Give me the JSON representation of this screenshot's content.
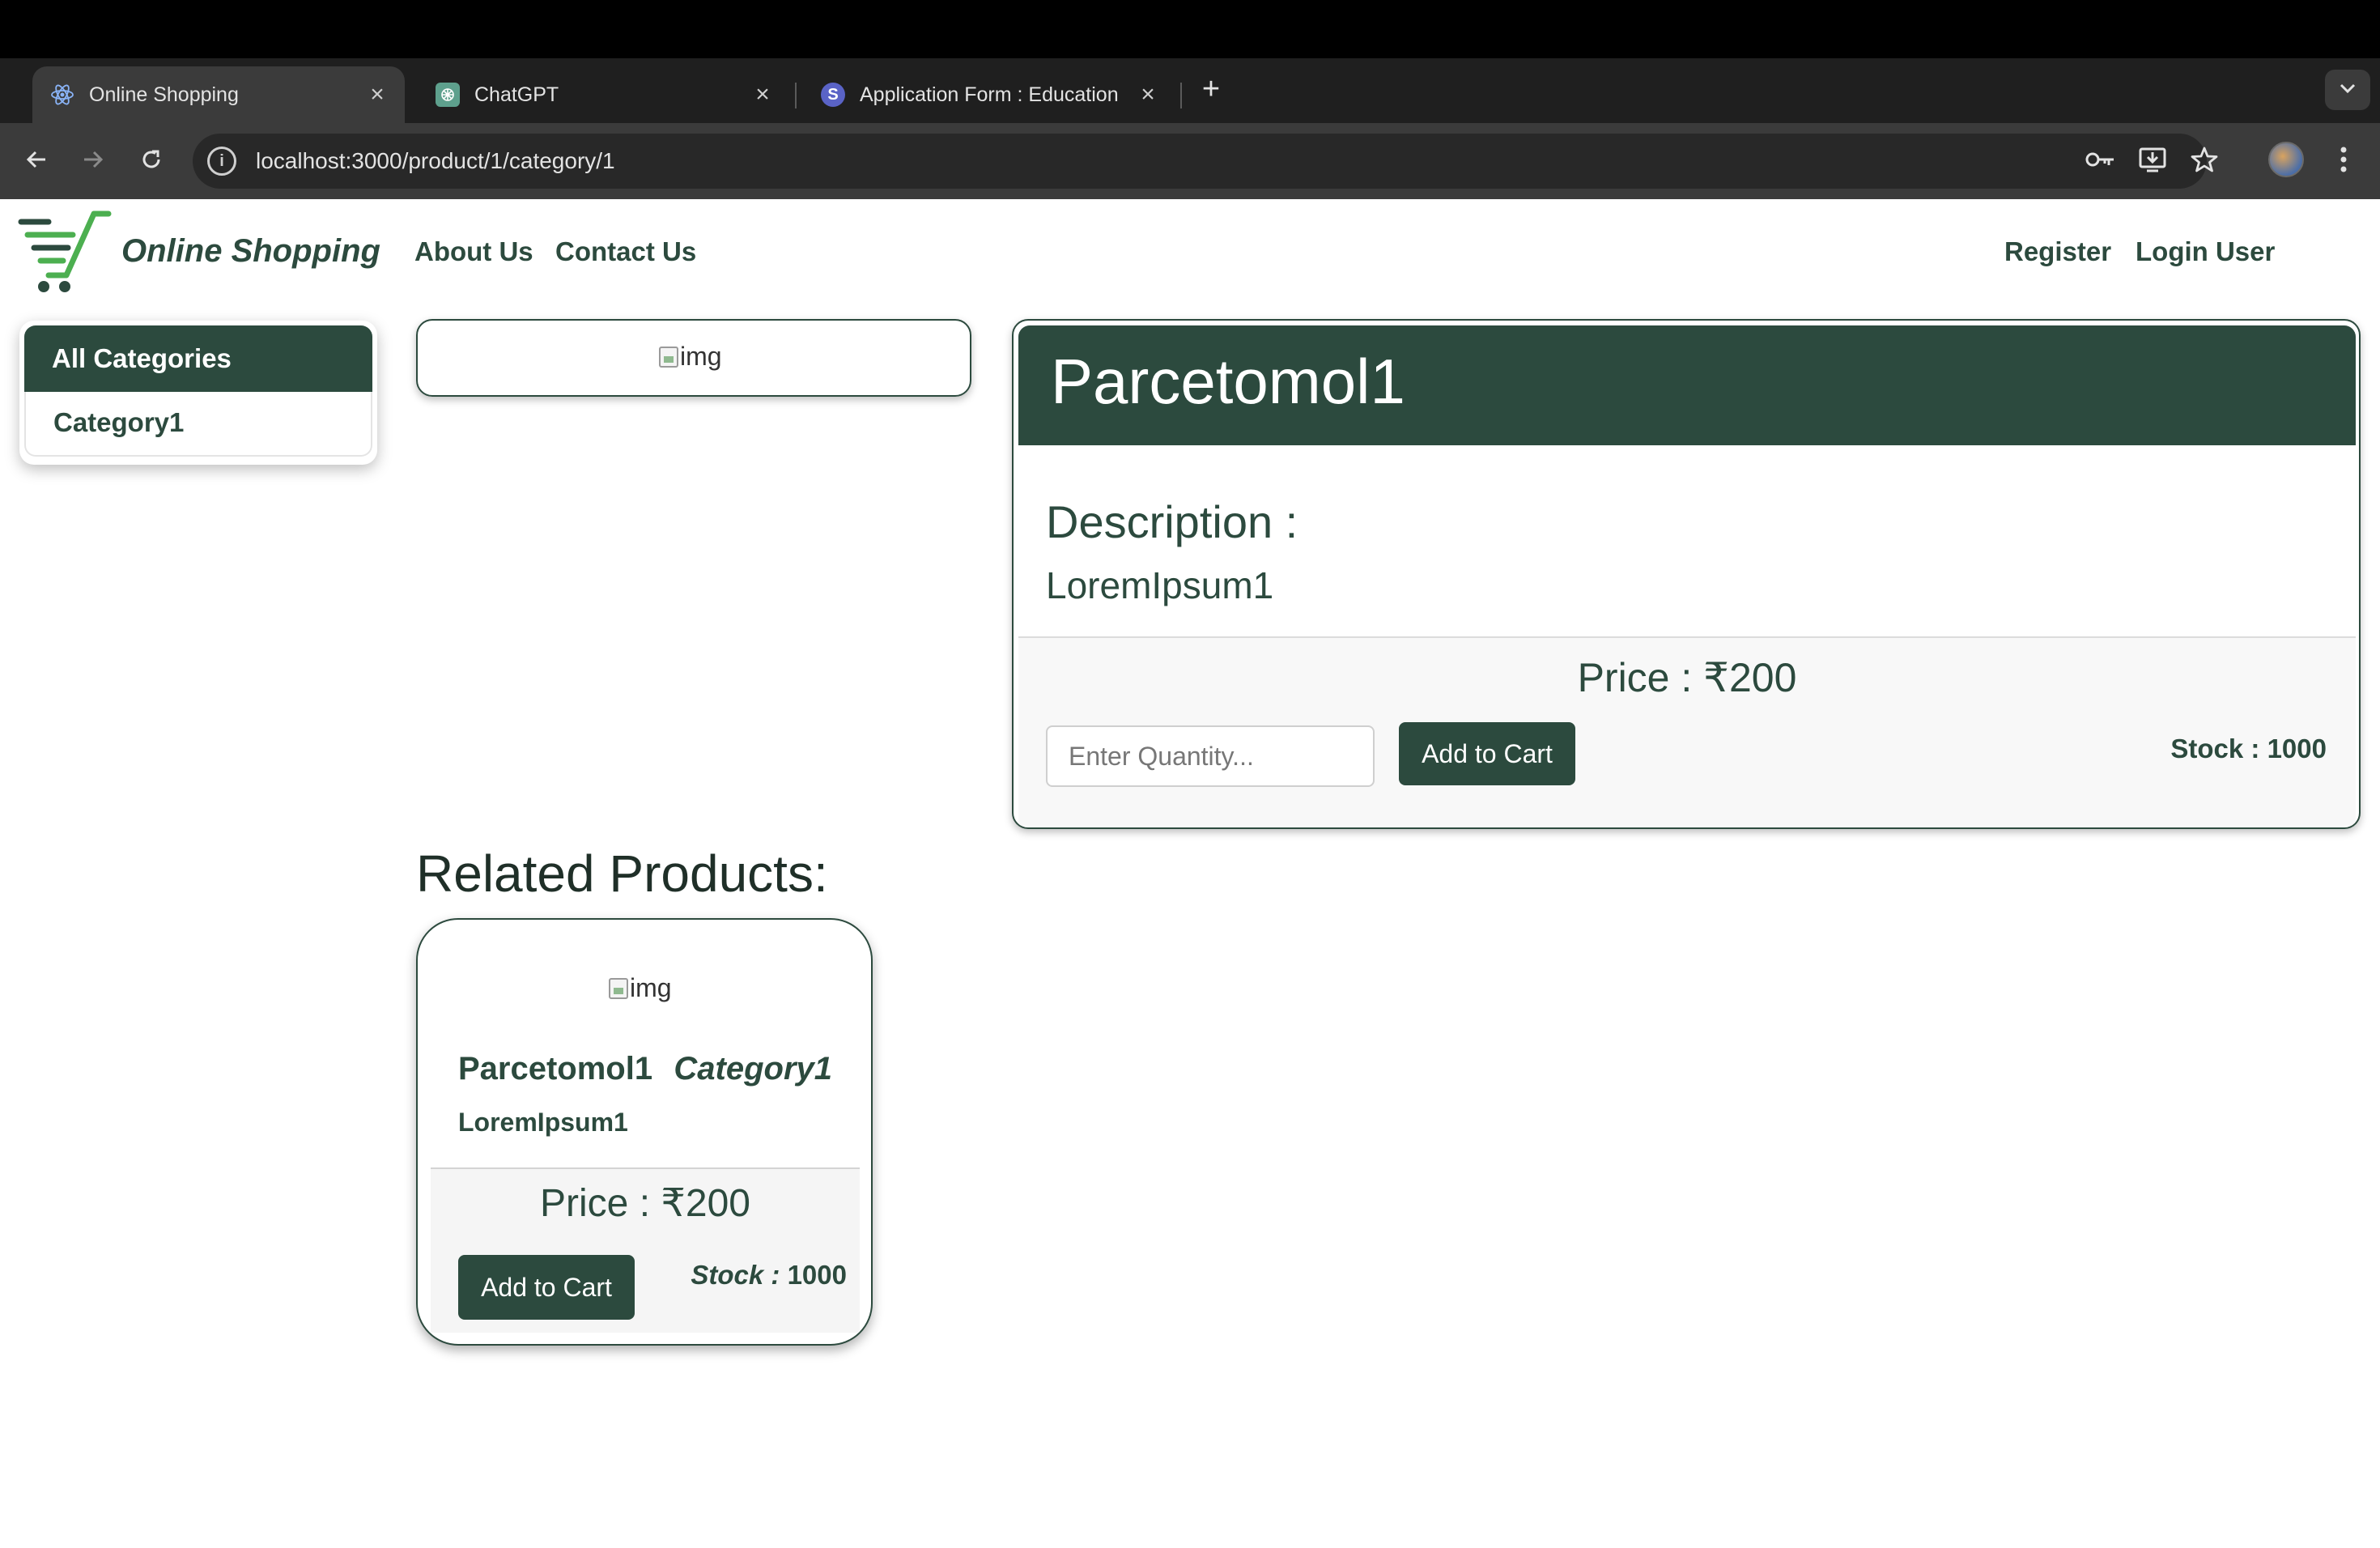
{
  "browser": {
    "tabs": [
      {
        "title": "Online Shopping",
        "active": true,
        "icon": "react-icon"
      },
      {
        "title": "ChatGPT",
        "active": false,
        "icon": "chatgpt-icon"
      },
      {
        "title": "Application Form : Education",
        "active": false,
        "icon": "s-icon"
      }
    ],
    "url": "localhost:3000/product/1/category/1",
    "new_tab": "+",
    "close_glyph": "×"
  },
  "header": {
    "brand": "Online Shopping",
    "nav": {
      "about": "About Us",
      "contact": "Contact Us",
      "register": "Register",
      "login": "Login User"
    }
  },
  "sidebar": {
    "title": "All Categories",
    "items": [
      {
        "label": "Category1"
      }
    ]
  },
  "product": {
    "image_alt": "img",
    "title": "Parcetomol1",
    "description_label": "Description :",
    "description": "LoremIpsum1",
    "price": "Price : ₹200",
    "quantity_placeholder": "Enter Quantity...",
    "add_to_cart": "Add to Cart",
    "stock": "Stock : 1000"
  },
  "related": {
    "title": "Related Products:",
    "items": [
      {
        "image_alt": "img",
        "name": "Parcetomol1",
        "category": "Category1",
        "description": "LoremIpsum1",
        "price": "Price : ₹200",
        "add_to_cart": "Add to Cart",
        "stock_label": "Stock :",
        "stock_value": "1000"
      }
    ]
  },
  "colors": {
    "primary": "#2c4a3e",
    "logo_green": "#4caf50"
  }
}
